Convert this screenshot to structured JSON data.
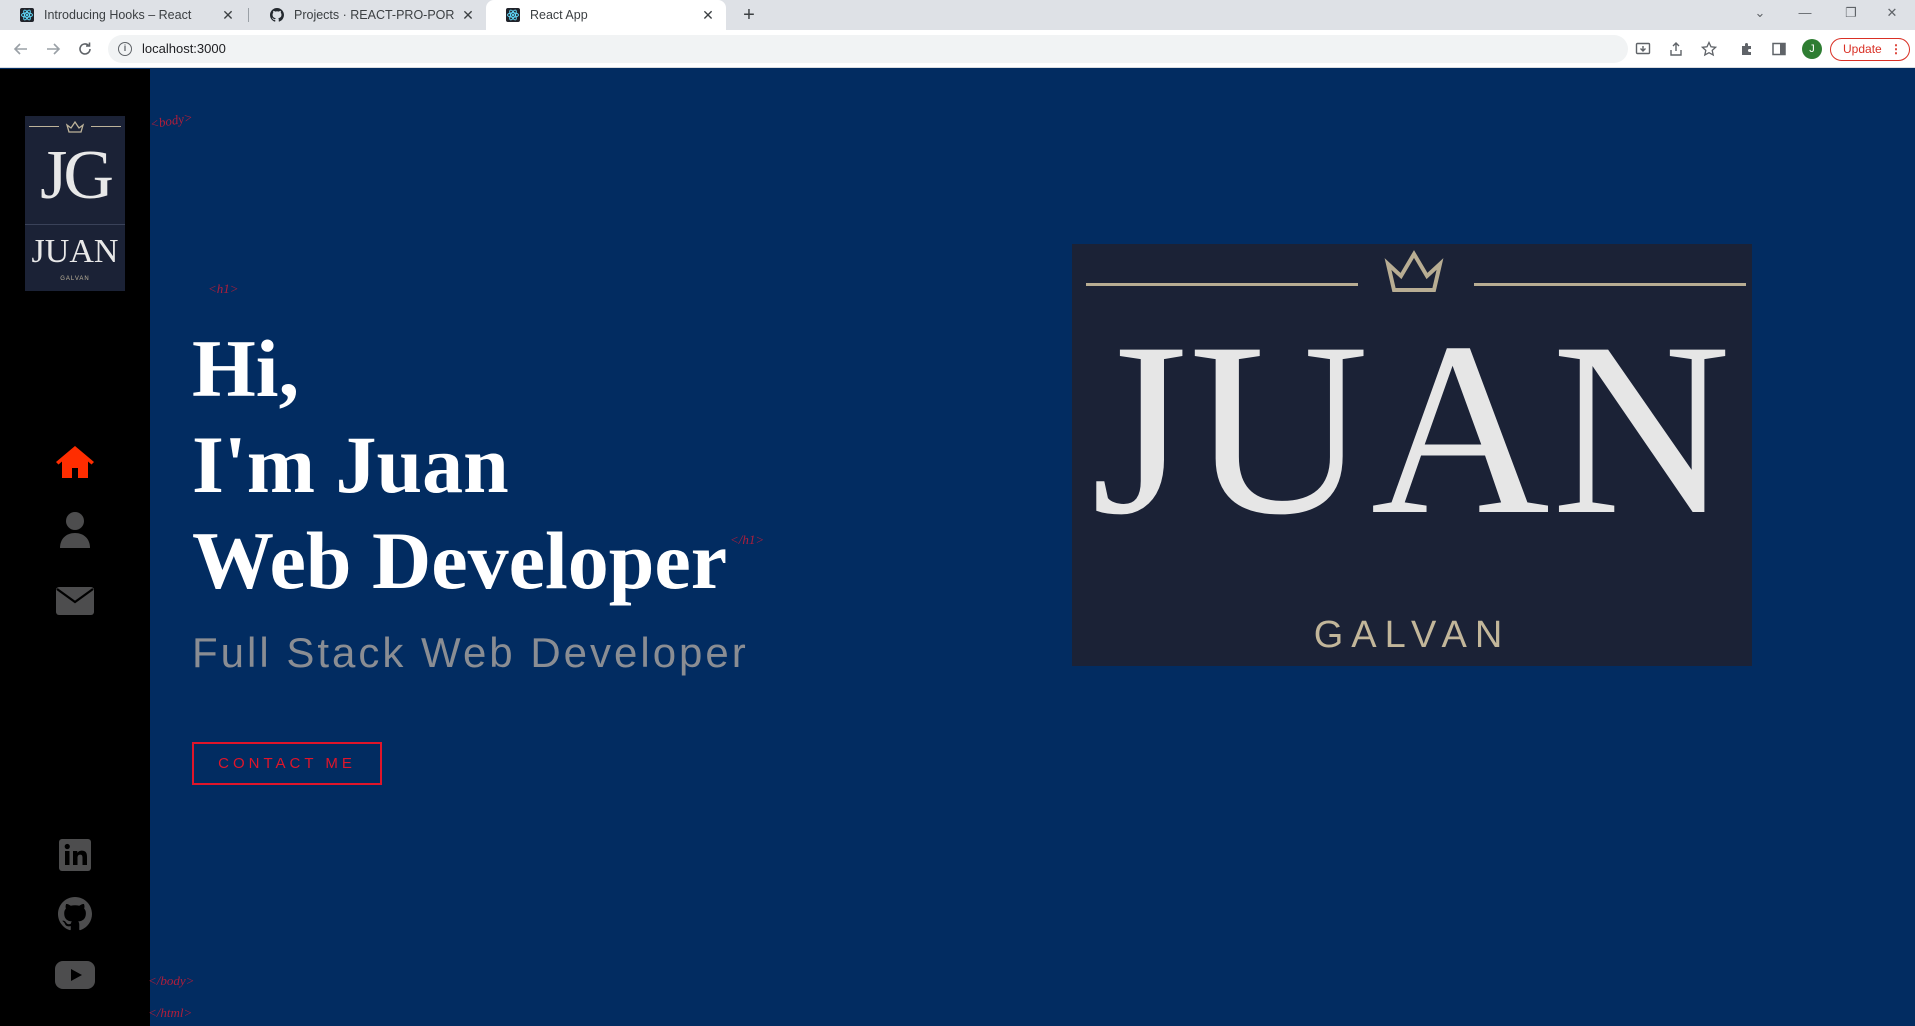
{
  "browser": {
    "tabs": [
      {
        "title": "Introducing Hooks – React",
        "favicon": "react-icon",
        "active": false
      },
      {
        "title": "Projects · REACT-PRO-PORTFOLIO",
        "favicon": "github-icon",
        "active": false
      },
      {
        "title": "React App",
        "favicon": "react-icon",
        "active": true
      }
    ],
    "url": "localhost:3000",
    "profile_initial": "J",
    "update_label": "Update"
  },
  "logo_small": {
    "monogram": "JG",
    "name": "JUAN",
    "surname": "GALVAN"
  },
  "sidebar": {
    "nav": [
      {
        "name": "home",
        "icon": "home-icon",
        "active": true
      },
      {
        "name": "about",
        "icon": "user-icon",
        "active": false
      },
      {
        "name": "contact",
        "icon": "envelope-icon",
        "active": false
      }
    ],
    "social": [
      {
        "name": "linkedin",
        "icon": "linkedin-icon"
      },
      {
        "name": "github",
        "icon": "github-icon"
      },
      {
        "name": "youtube",
        "icon": "youtube-icon"
      }
    ]
  },
  "tags": {
    "body_open": "<body>",
    "h1_open": "<h1>",
    "h1_close": "</h1>",
    "body_close": "</body>",
    "html_close": "</html>"
  },
  "hero": {
    "line1": "Hi,",
    "line2": "I'm Juan",
    "line3": "Web Developer",
    "subtitle": "Full Stack Web Developer",
    "cta_label": "CONTACT ME"
  },
  "logo_large": {
    "name": "JUAN",
    "surname": "GALVAN"
  },
  "colors": {
    "page_bg": "#022c61",
    "sidebar_bg": "#000000",
    "accent_red": "#e0152a",
    "active_icon": "#ff2d00",
    "inactive_icon": "#4d4d4e",
    "logo_bg": "#1b2236",
    "logo_gold": "#c2b69a"
  }
}
